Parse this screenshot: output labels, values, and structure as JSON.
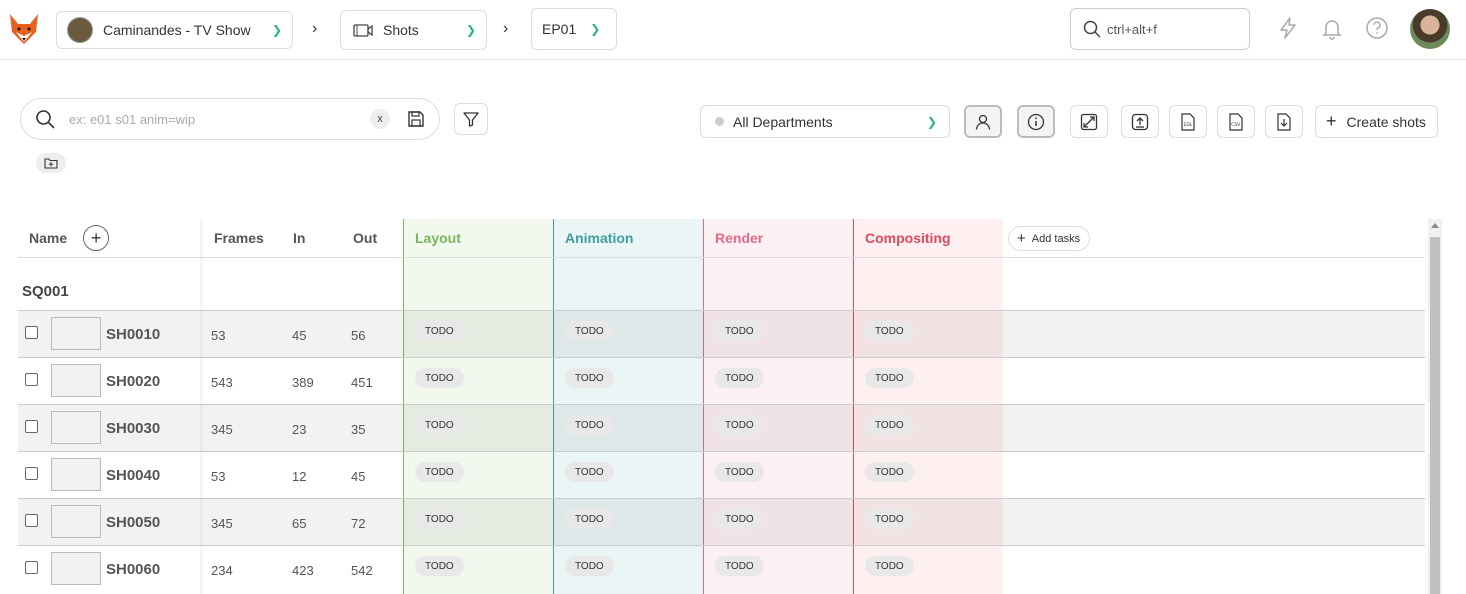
{
  "topbar": {
    "production": "Caminandes - TV Show",
    "section": "Shots",
    "episode": "EP01",
    "global_search_value": "ctrl+alt+f"
  },
  "filters": {
    "search_placeholder": "ex: e01 s01 anim=wip",
    "clear_label": "x",
    "department": "All Departments",
    "create_label": "Create shots"
  },
  "table": {
    "headers": {
      "name": "Name",
      "frames": "Frames",
      "in": "In",
      "out": "Out",
      "add_tasks": "Add tasks"
    },
    "task_types": [
      {
        "name": "Layout",
        "color": "#7ab55c"
      },
      {
        "name": "Animation",
        "color": "#3f9e9e"
      },
      {
        "name": "Render",
        "color": "#e26b8b"
      },
      {
        "name": "Compositing",
        "color": "#e04a5f"
      }
    ],
    "sequence": "SQ001",
    "rows": [
      {
        "name": "SH0010",
        "frames": "53",
        "in": "45",
        "out": "56",
        "statuses": [
          "TODO",
          "TODO",
          "TODO",
          "TODO"
        ]
      },
      {
        "name": "SH0020",
        "frames": "543",
        "in": "389",
        "out": "451",
        "statuses": [
          "TODO",
          "TODO",
          "TODO",
          "TODO"
        ]
      },
      {
        "name": "SH0030",
        "frames": "345",
        "in": "23",
        "out": "35",
        "statuses": [
          "TODO",
          "TODO",
          "TODO",
          "TODO"
        ]
      },
      {
        "name": "SH0040",
        "frames": "53",
        "in": "12",
        "out": "45",
        "statuses": [
          "TODO",
          "TODO",
          "TODO",
          "TODO"
        ]
      },
      {
        "name": "SH0050",
        "frames": "345",
        "in": "65",
        "out": "72",
        "statuses": [
          "TODO",
          "TODO",
          "TODO",
          "TODO"
        ]
      },
      {
        "name": "SH0060",
        "frames": "234",
        "in": "423",
        "out": "542",
        "statuses": [
          "TODO",
          "TODO",
          "TODO",
          "TODO"
        ]
      }
    ]
  }
}
